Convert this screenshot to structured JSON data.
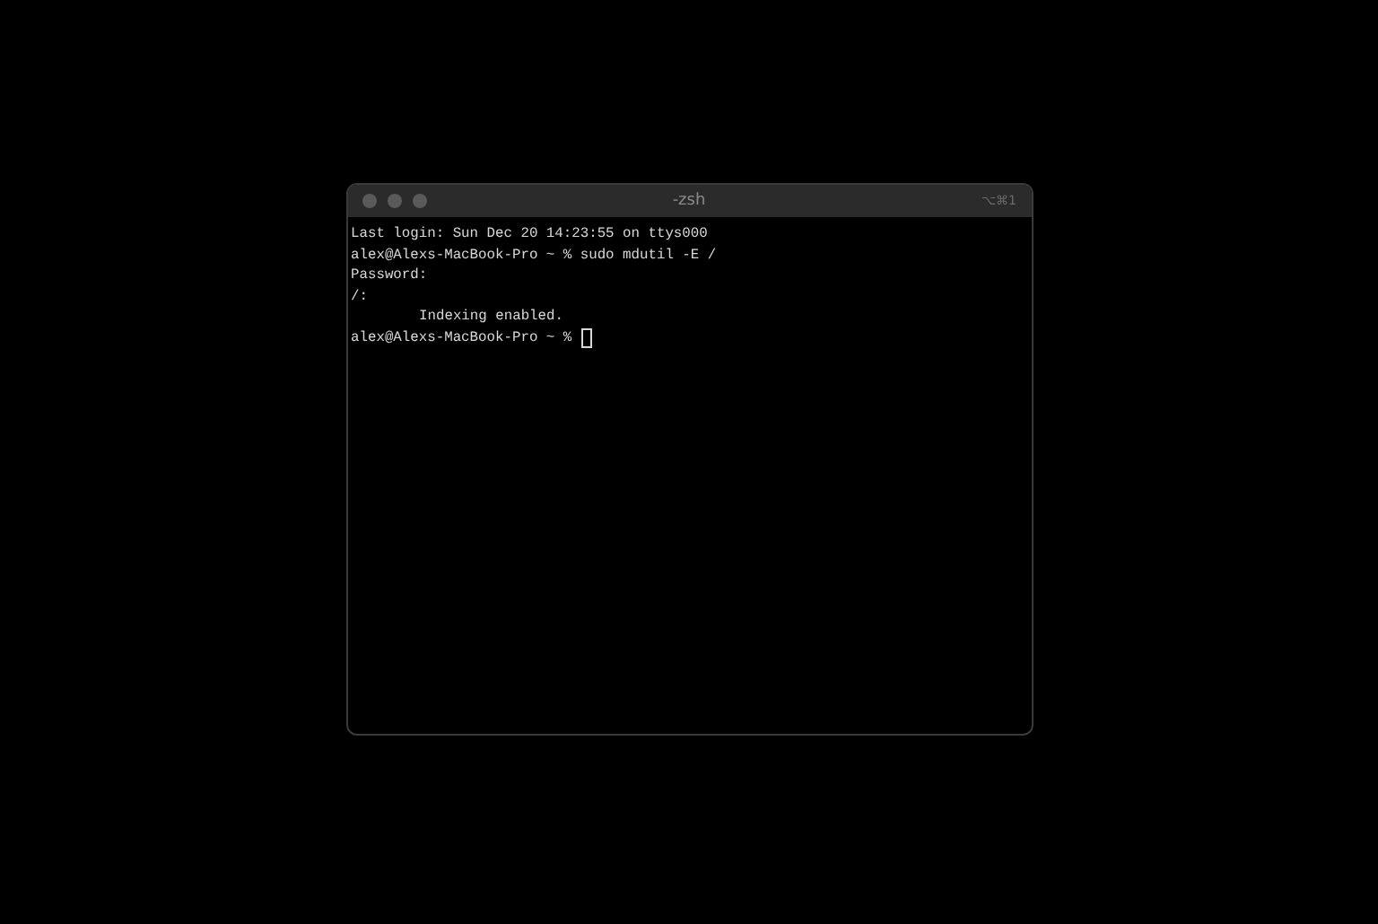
{
  "window": {
    "title": "-zsh",
    "shortcut": "⌥⌘1"
  },
  "lines": [
    {
      "kind": "output",
      "text": "Last login: Sun Dec 20 14:23:55 on ttys000"
    },
    {
      "kind": "output",
      "text": "alex@Alexs-MacBook-Pro ~ % sudo mdutil -E /"
    },
    {
      "kind": "output",
      "text": "Password:"
    },
    {
      "kind": "output",
      "text": "/:"
    },
    {
      "kind": "indented",
      "text": "Indexing enabled."
    },
    {
      "kind": "prompt",
      "text": "alex@Alexs-MacBook-Pro ~ %"
    }
  ]
}
